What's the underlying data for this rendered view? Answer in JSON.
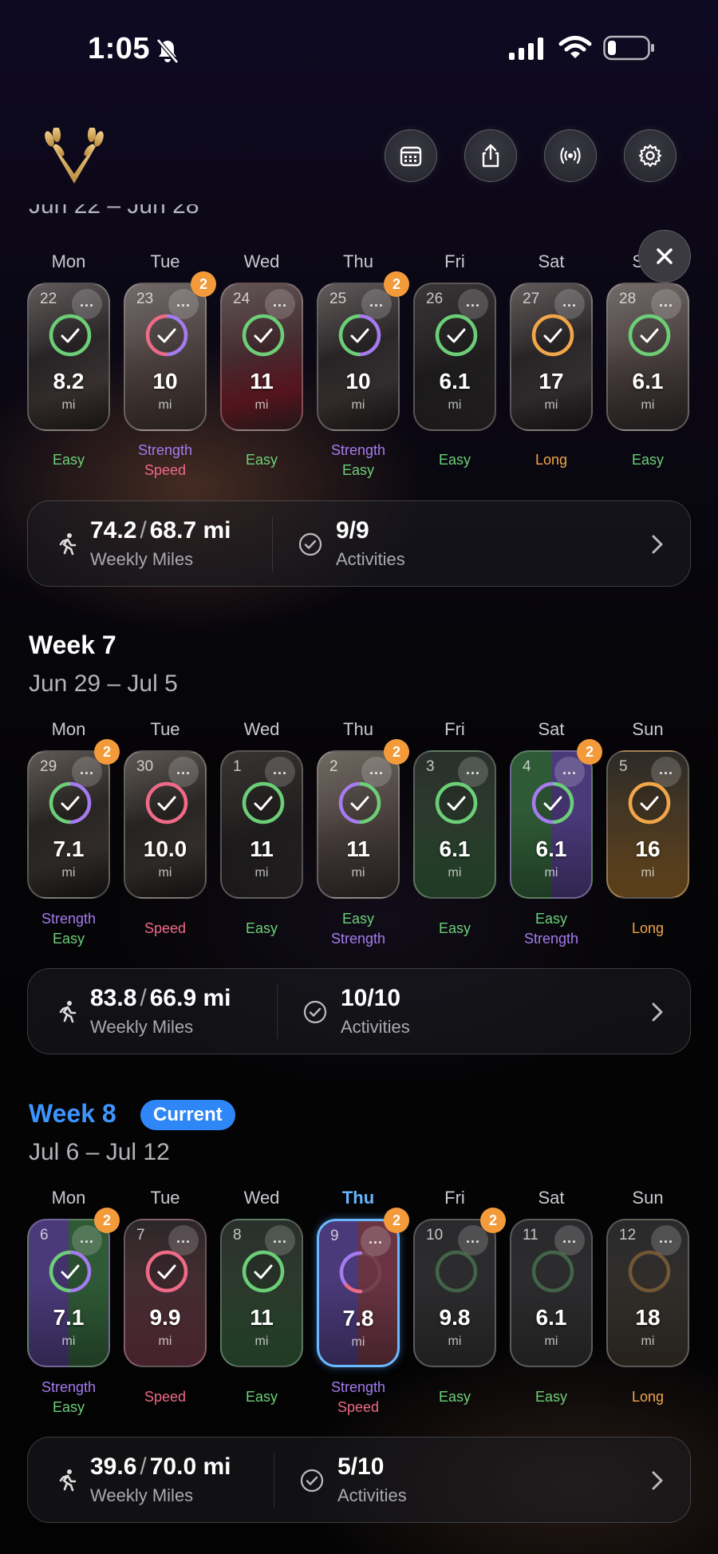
{
  "status_bar": {
    "time": "1:05"
  },
  "header": {
    "logo": "laurel-v-logo",
    "buttons": [
      "calendar-icon",
      "share-icon",
      "broadcast-icon",
      "gear-icon"
    ]
  },
  "colors": {
    "easy": "#6ccf78",
    "strength": "#a57bf0",
    "speed": "#ee6a87",
    "long": "#f2a64a",
    "badge": "#f39a3a",
    "current": "#3d95ff"
  },
  "days": [
    "Mon",
    "Tue",
    "Wed",
    "Thu",
    "Fri",
    "Sat",
    "Sun"
  ],
  "weeks": [
    {
      "title": "",
      "range": "Jun 22 – Jun 28",
      "today_index": -1,
      "tiles": [
        {
          "date": "22",
          "value": "8.2",
          "unit": "mi",
          "ring": "done",
          "badge": "",
          "types": [
            "Easy"
          ]
        },
        {
          "date": "23",
          "value": "10",
          "unit": "mi",
          "ring": "done",
          "badge": "2",
          "types": [
            "Strength",
            "Speed"
          ]
        },
        {
          "date": "24",
          "value": "11",
          "unit": "mi",
          "ring": "done",
          "badge": "",
          "types": [
            "Easy"
          ]
        },
        {
          "date": "25",
          "value": "10",
          "unit": "mi",
          "ring": "done",
          "badge": "2",
          "types": [
            "Strength",
            "Easy"
          ]
        },
        {
          "date": "26",
          "value": "6.1",
          "unit": "mi",
          "ring": "done",
          "badge": "",
          "types": [
            "Easy"
          ]
        },
        {
          "date": "27",
          "value": "17",
          "unit": "mi",
          "ring": "done",
          "badge": "",
          "types": [
            "Long"
          ]
        },
        {
          "date": "28",
          "value": "6.1",
          "unit": "mi",
          "ring": "done",
          "badge": "",
          "types": [
            "Easy"
          ]
        }
      ],
      "summary": {
        "miles": "74.2",
        "target": "68.7 mi",
        "miles_label": "Weekly Miles",
        "activities": "9/9",
        "activities_label": "Activities"
      }
    },
    {
      "title": "Week 7",
      "range": "Jun 29 – Jul 5",
      "today_index": -1,
      "tiles": [
        {
          "date": "29",
          "value": "7.1",
          "unit": "mi",
          "ring": "done",
          "badge": "2",
          "types": [
            "Strength",
            "Easy"
          ]
        },
        {
          "date": "30",
          "value": "10.0",
          "unit": "mi",
          "ring": "done",
          "badge": "",
          "types": [
            "Speed"
          ]
        },
        {
          "date": "1",
          "value": "11",
          "unit": "mi",
          "ring": "done",
          "badge": "",
          "types": [
            "Easy"
          ]
        },
        {
          "date": "2",
          "value": "11",
          "unit": "mi",
          "ring": "done",
          "badge": "2",
          "types": [
            "Easy",
            "Strength"
          ]
        },
        {
          "date": "3",
          "value": "6.1",
          "unit": "mi",
          "ring": "done",
          "badge": "",
          "types": [
            "Easy"
          ]
        },
        {
          "date": "4",
          "value": "6.1",
          "unit": "mi",
          "ring": "done",
          "badge": "2",
          "types": [
            "Easy",
            "Strength"
          ]
        },
        {
          "date": "5",
          "value": "16",
          "unit": "mi",
          "ring": "done",
          "badge": "",
          "types": [
            "Long"
          ]
        }
      ],
      "summary": {
        "miles": "83.8",
        "target": "66.9 mi",
        "miles_label": "Weekly Miles",
        "activities": "10/10",
        "activities_label": "Activities"
      }
    },
    {
      "title": "Week 8",
      "badge": "Current",
      "range": "Jul 6 – Jul 12",
      "today_index": 3,
      "tiles": [
        {
          "date": "6",
          "value": "7.1",
          "unit": "mi",
          "ring": "done",
          "badge": "2",
          "types": [
            "Strength",
            "Easy"
          ]
        },
        {
          "date": "7",
          "value": "9.9",
          "unit": "mi",
          "ring": "done",
          "badge": "",
          "types": [
            "Speed"
          ]
        },
        {
          "date": "8",
          "value": "11",
          "unit": "mi",
          "ring": "done",
          "badge": "",
          "types": [
            "Easy"
          ]
        },
        {
          "date": "9",
          "value": "7.8",
          "unit": "mi",
          "ring": "partial",
          "badge": "2",
          "types": [
            "Strength",
            "Speed"
          ]
        },
        {
          "date": "10",
          "value": "9.8",
          "unit": "mi",
          "ring": "empty",
          "badge": "2",
          "types": [
            "Easy"
          ]
        },
        {
          "date": "11",
          "value": "6.1",
          "unit": "mi",
          "ring": "empty",
          "badge": "",
          "types": [
            "Easy"
          ]
        },
        {
          "date": "12",
          "value": "18",
          "unit": "mi",
          "ring": "empty",
          "badge": "",
          "types": [
            "Long"
          ]
        }
      ],
      "summary": {
        "miles": "39.6",
        "target": "70.0 mi",
        "miles_label": "Weekly Miles",
        "activities": "5/10",
        "activities_label": "Activities"
      }
    }
  ]
}
